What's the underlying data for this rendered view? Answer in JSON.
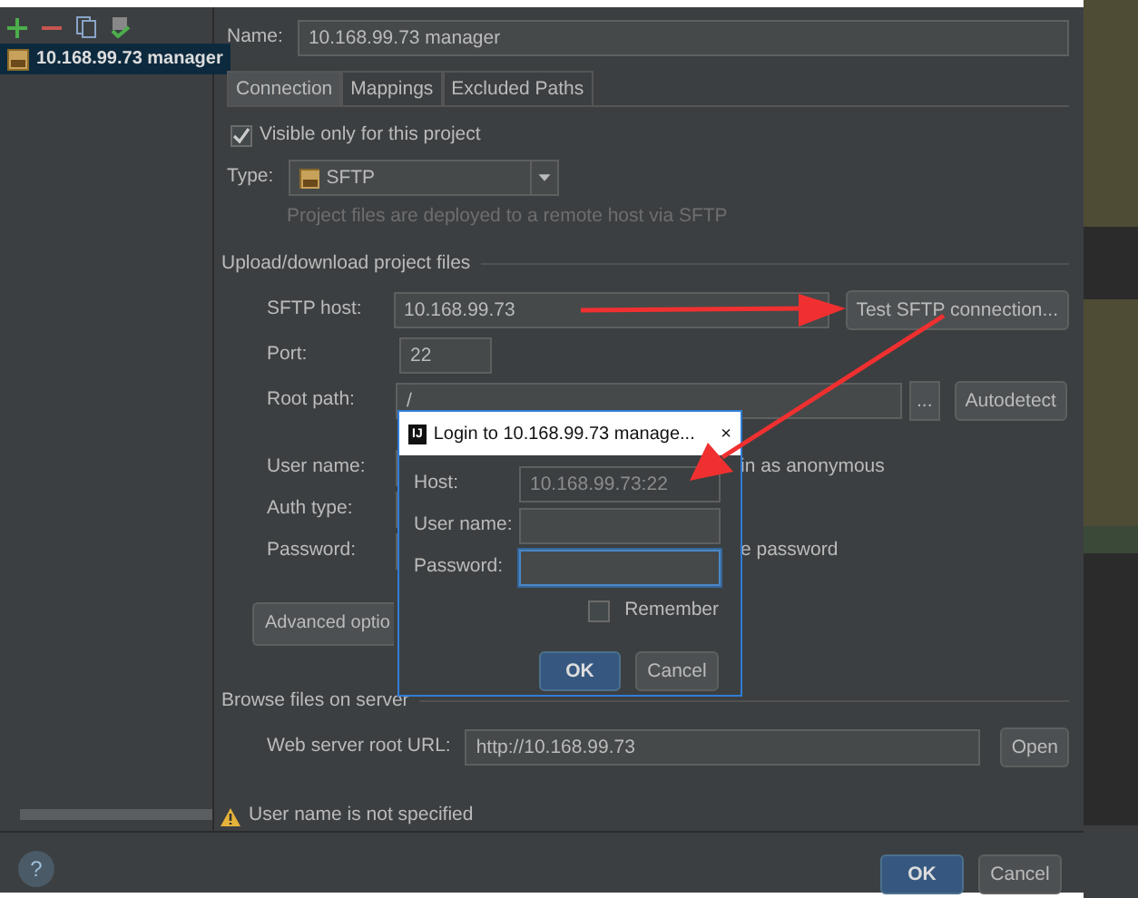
{
  "servers": [
    {
      "label": "10.168.99.73 manager",
      "selected": true
    }
  ],
  "name": {
    "label": "Name:",
    "value": "10.168.99.73 manager"
  },
  "tabs": [
    {
      "label": "Connection",
      "selected": true
    },
    {
      "label": "Mappings",
      "selected": false
    },
    {
      "label": "Excluded Paths",
      "selected": false
    }
  ],
  "visible_only": {
    "label": "Visible only for this project",
    "checked": true
  },
  "type": {
    "label": "Type:",
    "value": "SFTP",
    "hint": "Project files are deployed to a remote host via SFTP"
  },
  "upload": {
    "title": "Upload/download project files",
    "sftp_host": {
      "label": "SFTP host:",
      "value": "10.168.99.73",
      "button": "Test SFTP connection..."
    },
    "port": {
      "label": "Port:",
      "value": "22"
    },
    "root_path": {
      "label": "Root path:",
      "value": "/",
      "browse": "...",
      "button": "Autodetect"
    },
    "user_name": {
      "label": "User name:",
      "option": "in as anonymous"
    },
    "auth_type": {
      "label": "Auth type:"
    },
    "password": {
      "label": "Password:",
      "option": "e password"
    },
    "advanced": "Advanced optio"
  },
  "browse": {
    "title": "Browse files on server",
    "url_label": "Web server root URL:",
    "url": "http://10.168.99.73",
    "button": "Open"
  },
  "warning": "User name is not specified",
  "footer": {
    "help": "?",
    "ok": "OK",
    "cancel": "Cancel"
  },
  "login": {
    "logo": "IJ",
    "title": "Login to 10.168.99.73 manage...",
    "close": "×",
    "host": {
      "label": "Host:",
      "value": "10.168.99.73:22"
    },
    "user_name": {
      "label": "User name:"
    },
    "password": {
      "label": "Password:",
      "focused": true
    },
    "remember": {
      "label": "Remember",
      "checked": false
    },
    "ok": "OK",
    "cancel": "Cancel"
  }
}
